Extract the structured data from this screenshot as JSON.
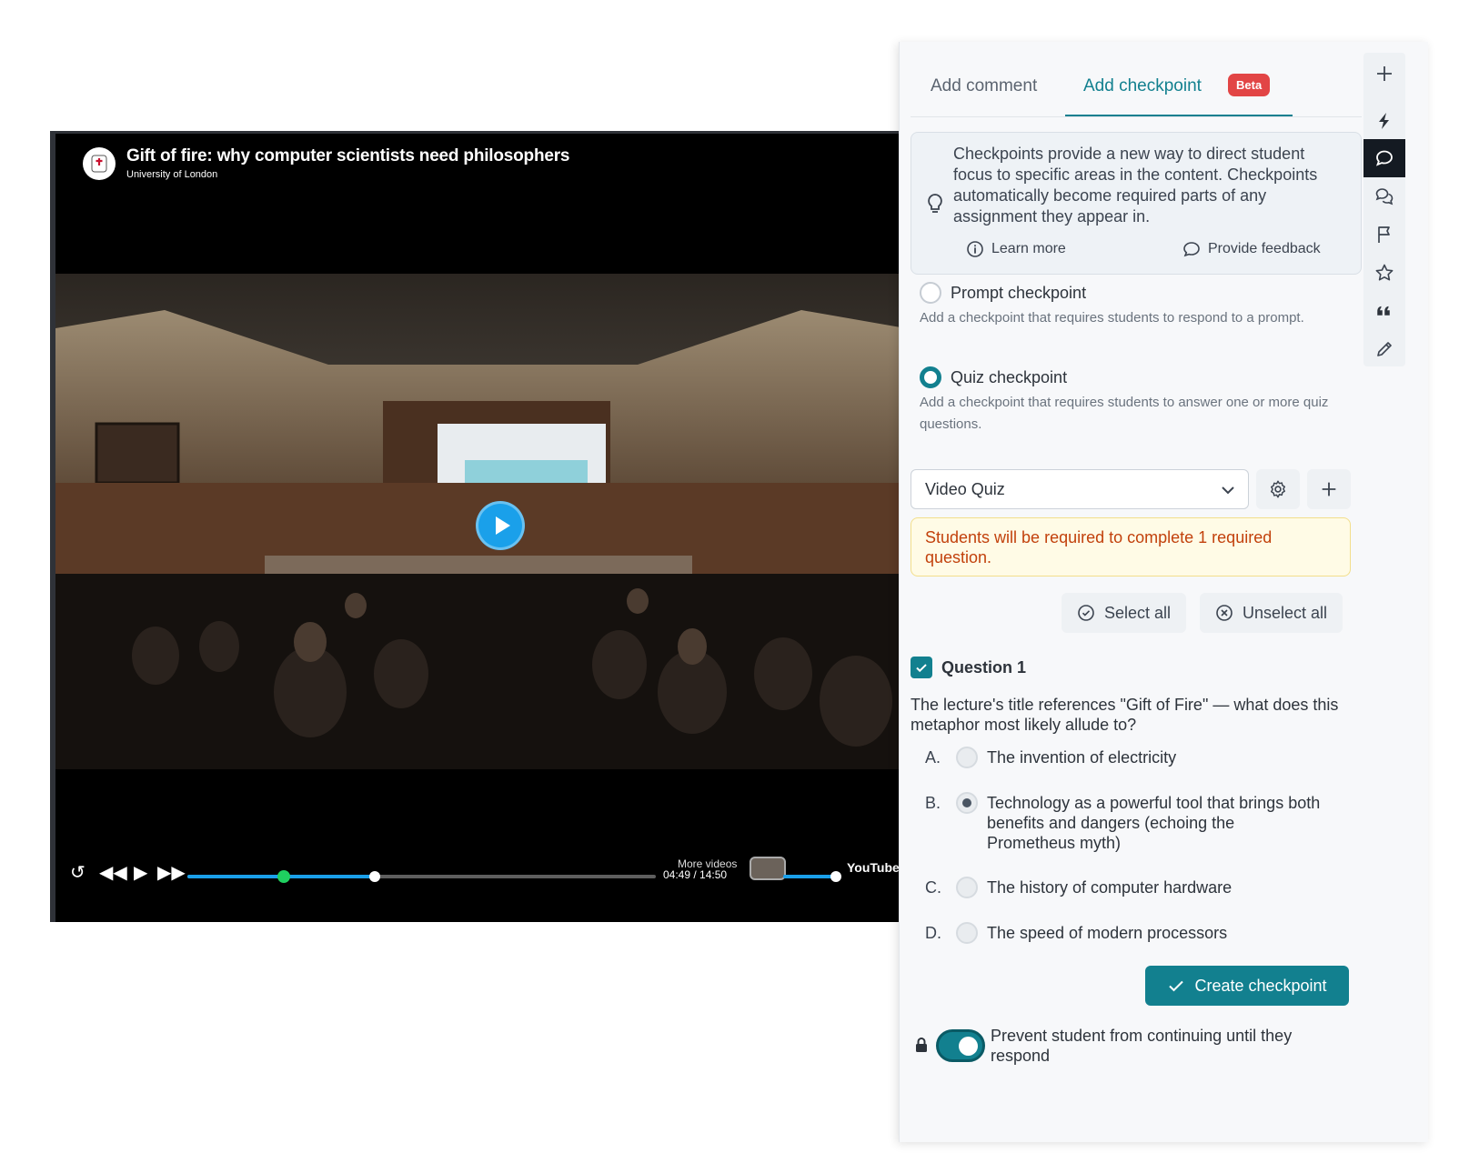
{
  "video": {
    "title": "Gift of fire: why computer scientists need philosophers",
    "channel": "University of London",
    "time": "04:49 / 14:50",
    "more_videos": "More videos",
    "progress_fraction": 0.4,
    "checkpoint_fraction": 0.205,
    "youtube_label": "YouTube"
  },
  "panel": {
    "tabs": {
      "comment": "Add comment",
      "checkpoint": "Add checkpoint",
      "badge": "Beta"
    },
    "info": {
      "text": "Checkpoints provide a new way to direct student focus to specific areas in the content. Checkpoints automatically become required parts of any assignment they appear in.",
      "learn_more": "Learn more",
      "feedback": "Provide feedback"
    },
    "options": {
      "prompt": {
        "label": "Prompt checkpoint",
        "desc": "Add a checkpoint that requires students to respond to a prompt."
      },
      "quiz": {
        "label": "Quiz checkpoint",
        "desc": "Add a checkpoint that requires students to answer one or more quiz questions."
      }
    },
    "quiz_select": {
      "value": "Video Quiz"
    },
    "warning": "Students will be required to complete 1 required question.",
    "select_all": "Select all",
    "unselect_all": "Unselect all",
    "question": {
      "title": "Question 1",
      "text": "The lecture's title references \"Gift of Fire\" — what does this metaphor most likely allude to?",
      "answers": [
        {
          "letter": "A.",
          "text": "The invention of electricity",
          "checked": false
        },
        {
          "letter": "B.",
          "text": "Technology as a powerful tool that brings both benefits and dangers (echoing the Prometheus myth)",
          "checked": true
        },
        {
          "letter": "C.",
          "text": "The history of computer hardware",
          "checked": false
        },
        {
          "letter": "D.",
          "text": "The speed of modern processors",
          "checked": false
        }
      ]
    },
    "create_button": "Create checkpoint",
    "toggle_label": "Prevent student from continuing until they respond",
    "toggle_on": true
  },
  "colors": {
    "accent": "#12808f",
    "beta": "#e24545",
    "warning_text": "#c2410c",
    "progress": "#1aa0ea",
    "checkpoint_marker": "#1fd060"
  },
  "rail_icons": [
    "plus-icon",
    "lightning-icon",
    "comment-icon",
    "comments-icon",
    "flag-icon",
    "star-icon",
    "quote-icon",
    "pencil-icon"
  ]
}
